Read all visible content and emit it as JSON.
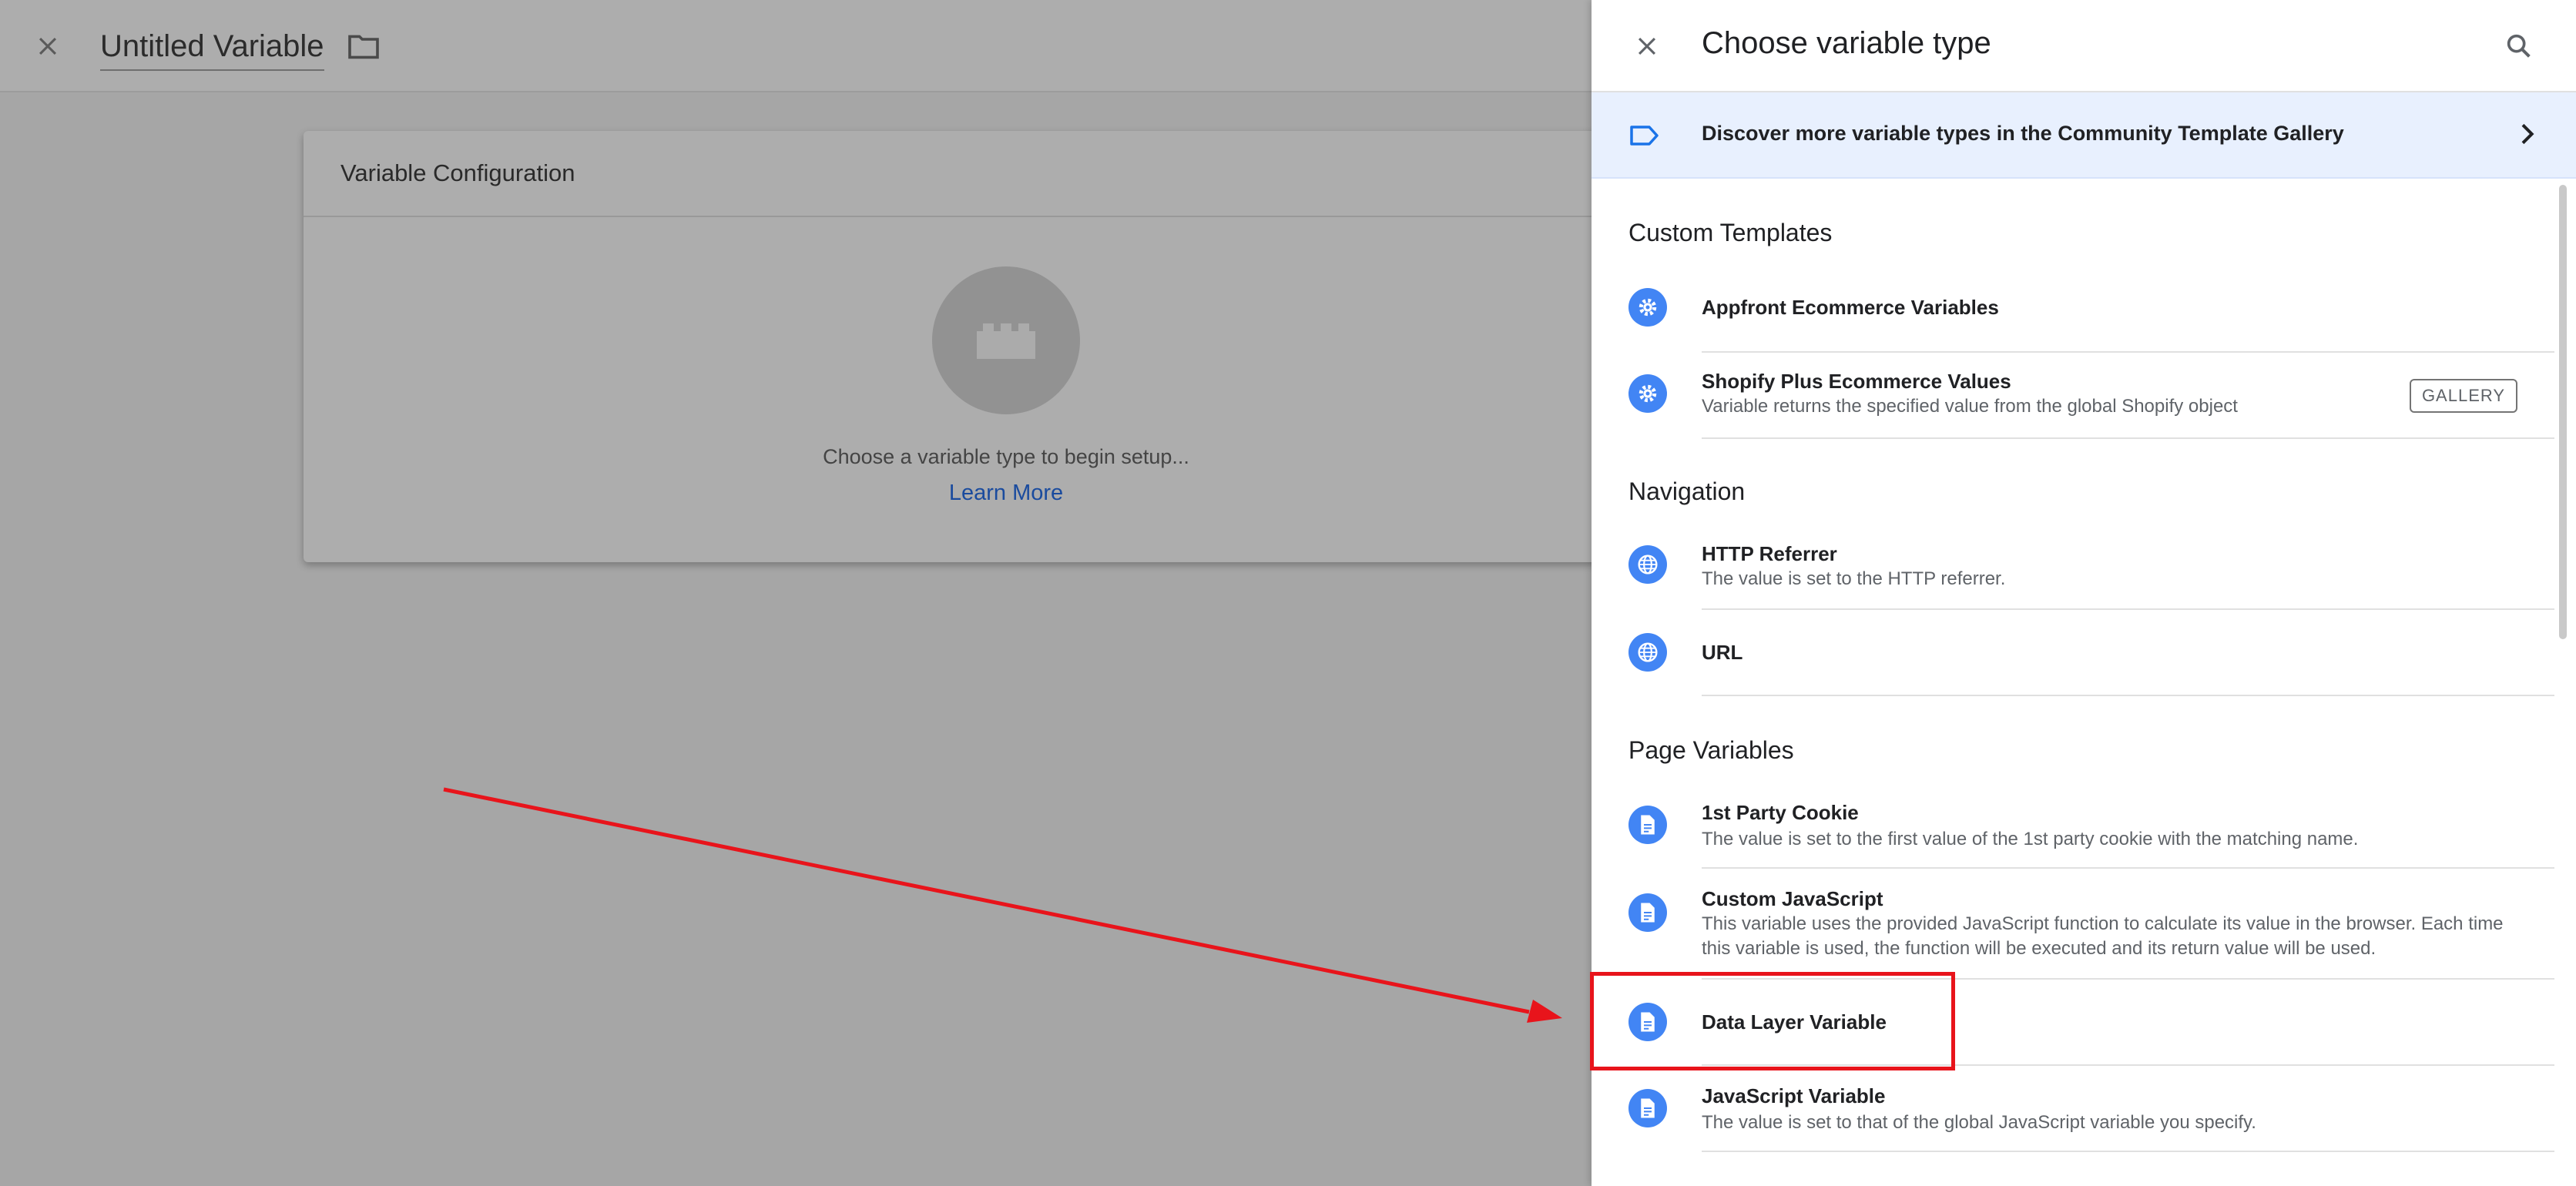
{
  "editor": {
    "title": "Untitled Variable",
    "card_title": "Variable Configuration",
    "placeholder_text": "Choose a variable type to begin setup...",
    "learn_more": "Learn More"
  },
  "panel": {
    "title": "Choose variable type",
    "gallery_banner": "Discover more variable types in the Community Template Gallery",
    "sections": {
      "custom": {
        "title": "Custom Templates",
        "items": [
          {
            "name": "Appfront Ecommerce Variables",
            "icon": "gear-icon"
          },
          {
            "name": "Shopify Plus Ecommerce Values",
            "description": "Variable returns the specified value from the global Shopify object",
            "chip": "GALLERY",
            "icon": "gear-icon"
          }
        ]
      },
      "navigation": {
        "title": "Navigation",
        "items": [
          {
            "name": "HTTP Referrer",
            "description": "The value is set to the HTTP referrer.",
            "icon": "globe-icon"
          },
          {
            "name": "URL",
            "icon": "globe-icon"
          }
        ]
      },
      "page": {
        "title": "Page Variables",
        "items": [
          {
            "name": "1st Party Cookie",
            "description": "The value is set to the first value of the 1st party cookie with the matching name.",
            "icon": "document-icon"
          },
          {
            "name": "Custom JavaScript",
            "description": "This variable uses the provided JavaScript function to calculate its value in the browser. Each time this variable is used, the function will be executed and its return value will be used.",
            "icon": "document-icon"
          },
          {
            "name": "Data Layer Variable",
            "icon": "document-icon"
          },
          {
            "name": "JavaScript Variable",
            "description": "The value is set to that of the global JavaScript variable you specify.",
            "icon": "document-icon"
          }
        ]
      }
    }
  },
  "colors": {
    "accent_blue": "#4285f4",
    "banner_bg": "#e8f0fe",
    "annotation_red": "#e8141b",
    "overlay_gray": "#a6a6a6"
  }
}
